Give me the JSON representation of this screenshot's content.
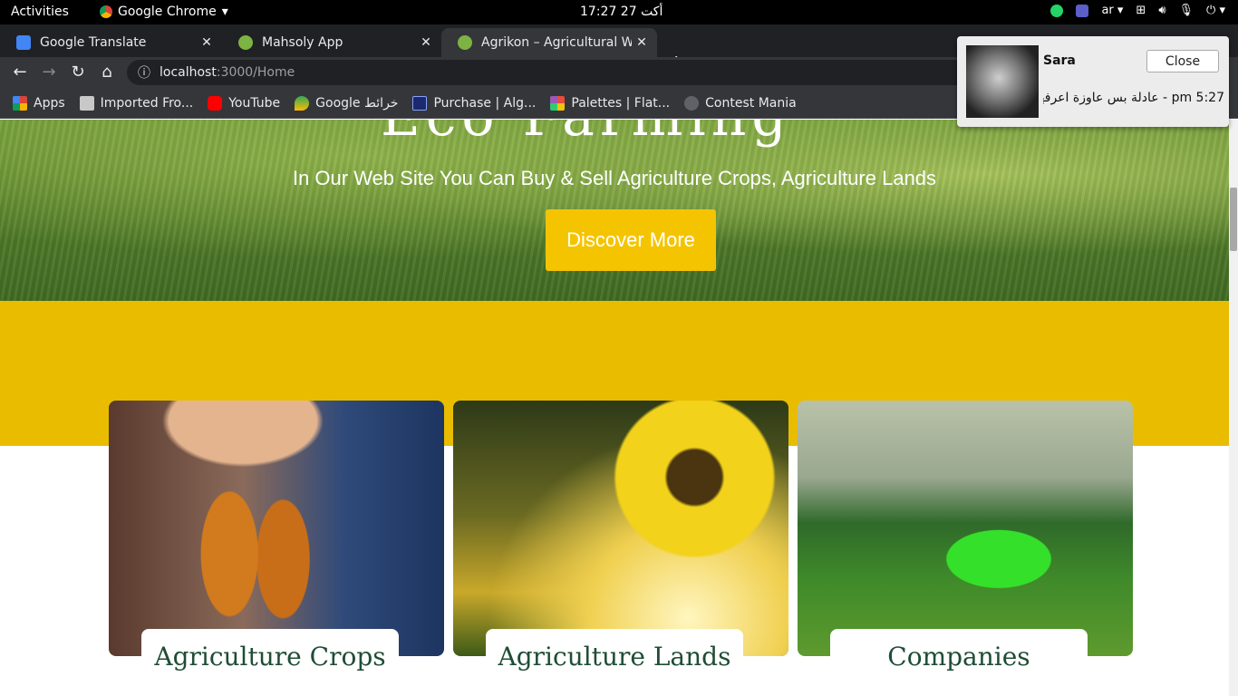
{
  "system_bar": {
    "activities": "Activities",
    "app_name": "Google Chrome",
    "clock": "17:27  27 أكت",
    "keyboard_layout": "ar"
  },
  "tabs": [
    {
      "title": "Google Translate",
      "favicon_color": "#4285f4"
    },
    {
      "title": "Mahsoly App",
      "favicon_color": "#7cb342"
    },
    {
      "title": "Agrikon – Agricultural WP",
      "favicon_color": "#7cb342"
    }
  ],
  "address_bar": {
    "host": "localhost",
    "path": ":3000/Home"
  },
  "bookmarks": [
    {
      "label": "Apps",
      "icon": "apps-grid-icon"
    },
    {
      "label": "Imported Fro...",
      "icon": "folder-icon"
    },
    {
      "label": "YouTube",
      "icon": "youtube-icon"
    },
    {
      "label": "Google خرائط",
      "icon": "maps-icon"
    },
    {
      "label": "Purchase | Alg...",
      "icon": "purchase-icon"
    },
    {
      "label": "Palettes | Flat...",
      "icon": "palettes-icon"
    },
    {
      "label": "Contest Mania",
      "icon": "code-icon"
    }
  ],
  "hero": {
    "title_fragment": "Eco Farming",
    "subtitle": "In Our Web Site You Can Buy & Sell Agriculture Crops, Agriculture Lands",
    "cta": "Discover More"
  },
  "cards": [
    {
      "label": "Agriculture Crops",
      "image": "carrots"
    },
    {
      "label": "Agriculture Lands",
      "image": "sunflower"
    },
    {
      "label": "Companies",
      "image": "harvester"
    }
  ],
  "notification": {
    "sender": "Sara",
    "message": "5:27 pm - عادلة بس عاوزة اعرفها",
    "close_label": "Close"
  },
  "colors": {
    "accent_yellow": "#e9bc00",
    "button_yellow": "#f5c400",
    "card_text_green": "#1f4d36"
  }
}
